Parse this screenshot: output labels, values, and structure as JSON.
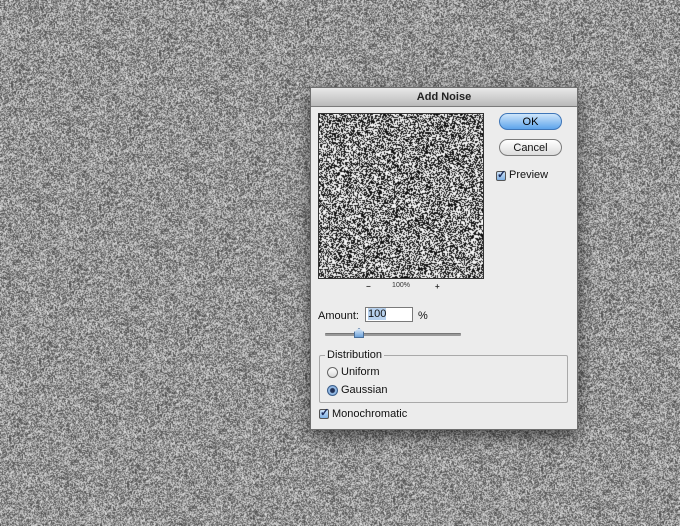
{
  "dialog": {
    "title": "Add Noise",
    "zoom": {
      "minus": "−",
      "level": "100%",
      "plus": "+"
    },
    "buttons": {
      "ok": "OK",
      "cancel": "Cancel"
    },
    "preview": {
      "label": "Preview",
      "checked": true
    },
    "amount": {
      "label": "Amount:",
      "value": "100",
      "unit": "%",
      "slider_fraction": 0.25
    },
    "distribution": {
      "legend": "Distribution",
      "options": [
        {
          "label": "Uniform",
          "selected": false
        },
        {
          "label": "Gaussian",
          "selected": true
        }
      ]
    },
    "monochromatic": {
      "label": "Monochromatic",
      "checked": true
    }
  },
  "colors": {
    "ok_button": "#5da4ec",
    "dialog_bg": "#ececec",
    "noise_bg": "#9a9a9a"
  },
  "icons": [
    "checkmark-icon",
    "radio-dot-icon",
    "slider-thumb-icon"
  ]
}
